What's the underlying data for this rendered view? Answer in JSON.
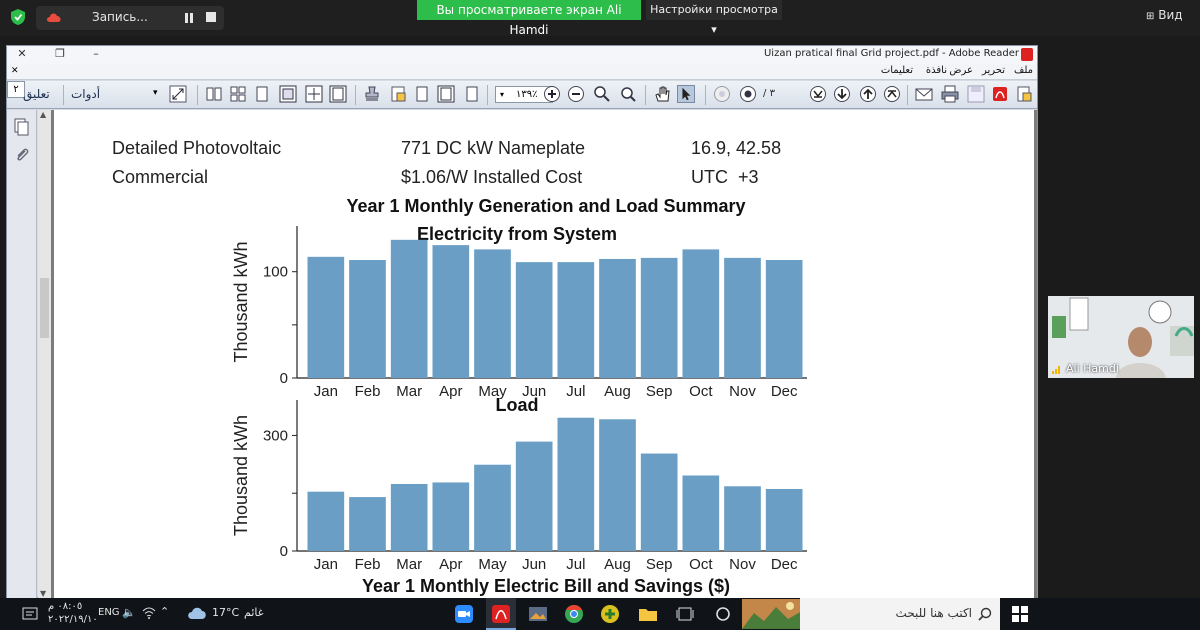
{
  "zoom": {
    "recording_label": "Запись...",
    "sharing_banner": "Вы просматриваете экран Ali Hamdi",
    "view_options": "Настройки просмотра",
    "view_button": "Вид",
    "participant_name": "Ali Hamdi",
    "banner_color": "#2dbd4a"
  },
  "adobe": {
    "window_title": "Uizan pratical final Grid project.pdf - Adobe Reader",
    "menu": [
      "ملف",
      "تحرير",
      "عرض",
      "نافذة",
      "تعليمات"
    ],
    "toolbar": {
      "comment_label": "تعليق",
      "tools_label": "أدوات",
      "zoom_value": "١٣٩٪",
      "page_current": "٢",
      "page_total": "/ ٣"
    }
  },
  "document": {
    "rows": [
      {
        "left": "Detailed Photovoltaic",
        "middle": "771 DC kW Nameplate",
        "right": "16.9, 42.58"
      },
      {
        "left": "Commercial",
        "middle": "$1.06/W Installed Cost",
        "right": "UTC  +3"
      }
    ],
    "main_heading": "Year 1 Monthly Generation and Load Summary",
    "bottom_heading": "Year 1 Monthly Electric Bill and Savings ($)"
  },
  "chart_data": [
    {
      "type": "bar",
      "title": "Electricity from System",
      "ylabel": "Thousand kWh",
      "categories": [
        "Jan",
        "Feb",
        "Mar",
        "Apr",
        "May",
        "Jun",
        "Jul",
        "Aug",
        "Sep",
        "Oct",
        "Nov",
        "Dec"
      ],
      "values": [
        114,
        111,
        130,
        125,
        121,
        109,
        109,
        112,
        113,
        121,
        113,
        111
      ],
      "ylim": [
        0,
        143
      ],
      "yticks": [
        0,
        100
      ],
      "bar_color": "#6a9ec5"
    },
    {
      "type": "bar",
      "title": "Load",
      "ylabel": "Thousand kWh",
      "categories": [
        "Jan",
        "Feb",
        "Mar",
        "Apr",
        "May",
        "Jun",
        "Jul",
        "Aug",
        "Sep",
        "Oct",
        "Nov",
        "Dec"
      ],
      "values": [
        154,
        140,
        174,
        178,
        224,
        284,
        346,
        342,
        253,
        196,
        168,
        161
      ],
      "ylim": [
        0,
        392
      ],
      "yticks": [
        0,
        300
      ],
      "bar_color": "#6a9ec5"
    }
  ],
  "taskbar": {
    "search_placeholder": "اكتب هنا للبحث",
    "weather_temp": "17°C",
    "weather_label": "غائم",
    "language": "ENG",
    "time": "٠٨:٠٥ م",
    "date": "٢٠٢٢/١٩/١٠"
  }
}
